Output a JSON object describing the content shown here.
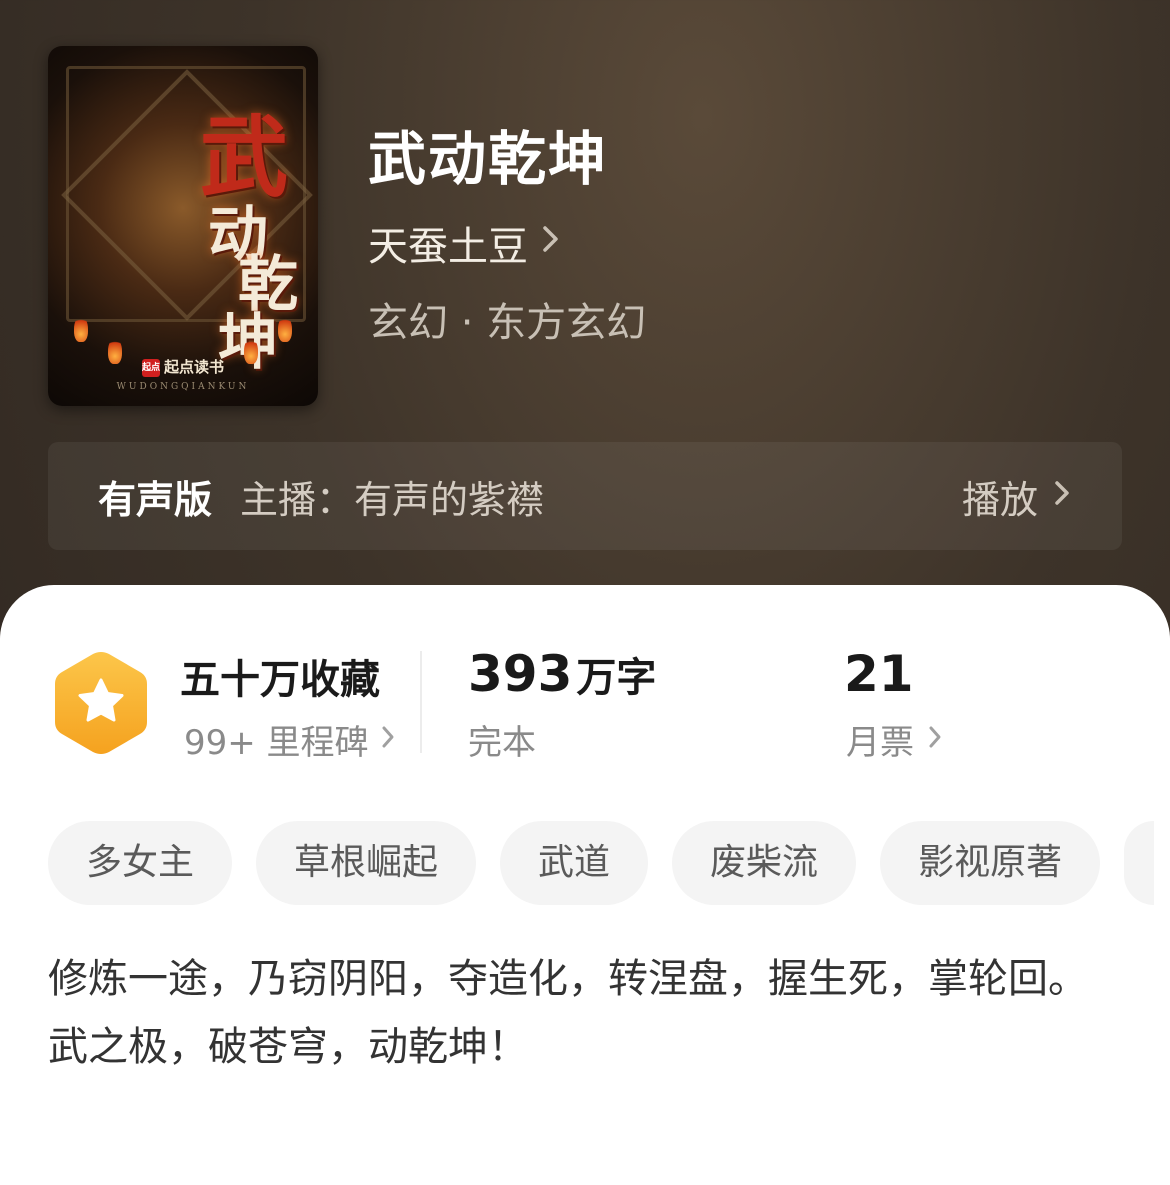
{
  "book": {
    "cover": {
      "title_chars": [
        "武",
        "动",
        "乾",
        "坤"
      ],
      "publisher": "起点读书",
      "publisher_logo": "起点",
      "pinyin": "WUDONGQIANKUN"
    },
    "title": "武动乾坤",
    "author": "天蚕土豆",
    "genre": "玄幻 · 东方玄幻"
  },
  "audio": {
    "label": "有声版",
    "anchor": "主播：有声的紫襟",
    "play_label": "播放"
  },
  "stats": {
    "collection_title": "五十万收藏",
    "milestone": "99+ 里程碑",
    "word_count": "393",
    "word_unit": "万字",
    "status": "完本",
    "monthly_votes": "21",
    "monthly_label": "月票"
  },
  "tags": [
    "多女主",
    "草根崛起",
    "武道",
    "废柴流",
    "影视原著"
  ],
  "intro": [
    "修炼一途，乃窃阴阳，夺造化，转涅盘，握生死，掌轮回。",
    "武之极，破苍穹，动乾坤！"
  ],
  "colors": {
    "badge_gradient_top": "#fcc64a",
    "badge_gradient_bottom": "#f5a21f",
    "header_bg": "#3d3329"
  },
  "icons": {
    "badge": "star-hexagon-icon",
    "chevron": "chevron-right-icon"
  }
}
